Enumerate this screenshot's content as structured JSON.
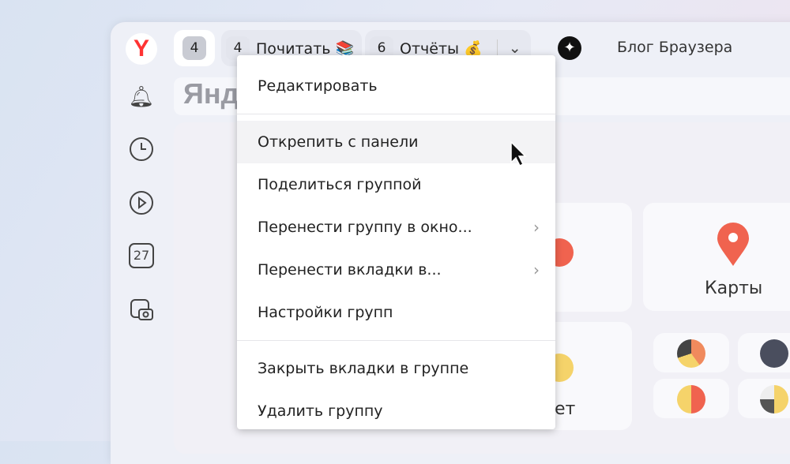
{
  "tabs": [
    {
      "count": "4",
      "label": ""
    },
    {
      "count": "4",
      "label": "Почитать 📚"
    },
    {
      "count": "6",
      "label": "Отчёты 💰"
    }
  ],
  "bookmark": "Блог Браузера",
  "sidebar": {
    "calendar_day": "27"
  },
  "search_logo_text": "Янд",
  "menu": {
    "items": [
      {
        "label": "Редактировать"
      },
      {
        "label": "Открепить с панели"
      },
      {
        "label": "Поделиться группой"
      },
      {
        "label": "Перенести группу в окно..."
      },
      {
        "label": "Перенести вкладки в..."
      },
      {
        "label": "Настройки групп"
      },
      {
        "label": "Закрыть вкладки в группе"
      },
      {
        "label": "Удалить группу"
      }
    ]
  },
  "tiles": {
    "maps": "Карты",
    "partial": "ет"
  },
  "colors": {
    "accent": "#f0634f",
    "logo": "#ff3333"
  }
}
